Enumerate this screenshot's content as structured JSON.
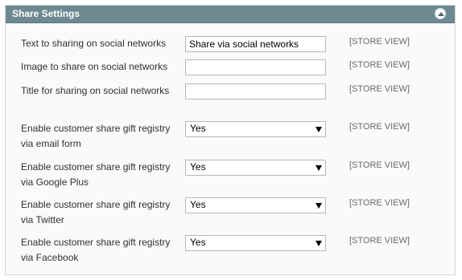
{
  "section": {
    "title": "Share Settings",
    "collapse_icon": "chevron-up-icon"
  },
  "rows": [
    {
      "label": "Text to sharing on social networks",
      "type": "text",
      "value": "Share via social networks",
      "scope": "[STORE VIEW]"
    },
    {
      "label": "Image to share on social networks",
      "type": "text",
      "value": "",
      "scope": "[STORE VIEW]"
    },
    {
      "label": "Title for sharing on social networks",
      "type": "text",
      "value": "",
      "scope": "[STORE VIEW]"
    },
    {
      "label": "Enable customer share gift registry via email form",
      "type": "select",
      "value": "Yes",
      "scope": "[STORE VIEW]"
    },
    {
      "label": "Enable customer share gift registry via Google Plus",
      "type": "select",
      "value": "Yes",
      "scope": "[STORE VIEW]"
    },
    {
      "label": "Enable customer share gift registry via Twitter",
      "type": "select",
      "value": "Yes",
      "scope": "[STORE VIEW]"
    },
    {
      "label": "Enable customer share gift registry via Facebook",
      "type": "select",
      "value": "Yes",
      "scope": "[STORE VIEW]"
    }
  ],
  "colors": {
    "header_bg": "#6f8992",
    "panel_bg": "#fafafa"
  }
}
